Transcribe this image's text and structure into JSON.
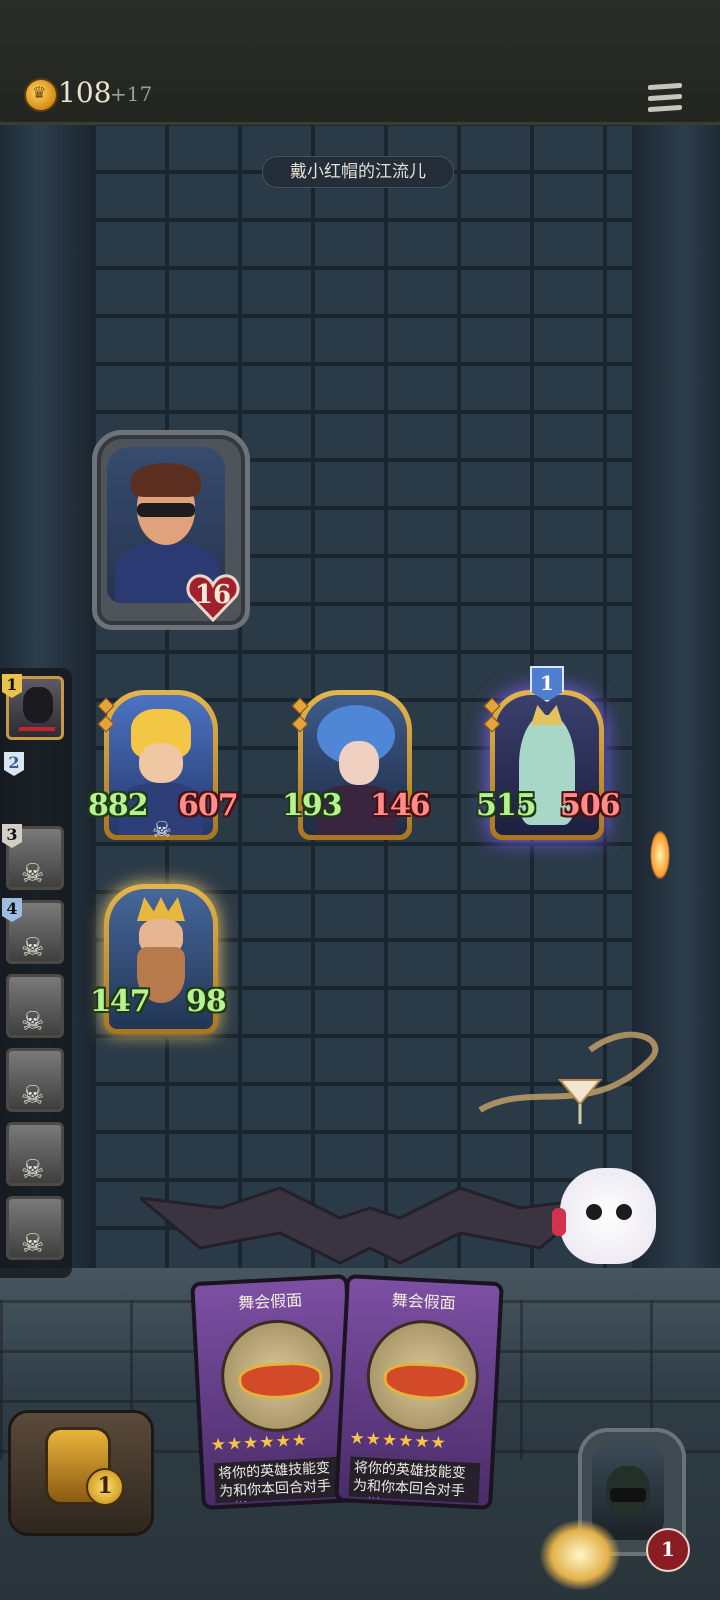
{
  "header": {
    "coins": "108",
    "income": "+17",
    "menu_icon": "hamburger-menu-icon"
  },
  "opponent": {
    "name": "戴小红帽的江流儿",
    "health": "16"
  },
  "board": {
    "minions": [
      {
        "attack": "882",
        "health": "607",
        "tier": null,
        "golden": true
      },
      {
        "attack": "193",
        "health": "146",
        "tier": null,
        "golden": true
      },
      {
        "attack": "515",
        "health": "506",
        "tier": "1",
        "golden": true
      },
      {
        "attack": "147",
        "health": "98",
        "tier": null,
        "golden": true
      }
    ]
  },
  "sidebar": {
    "slots": [
      {
        "rank": "1",
        "state": "active"
      },
      {
        "rank": "2",
        "state": "empty"
      },
      {
        "rank": "3",
        "state": "dead"
      },
      {
        "rank": "4",
        "state": "dead"
      },
      {
        "rank": "",
        "state": "dead"
      },
      {
        "rank": "",
        "state": "dead"
      },
      {
        "rank": "",
        "state": "dead"
      },
      {
        "rank": "",
        "state": "dead"
      }
    ]
  },
  "hand": [
    {
      "name": "舞会假面",
      "stars": "★★★★★★",
      "desc": "将你的英雄技能变为和你本回合对手一样"
    },
    {
      "name": "舞会假面",
      "stars": "★★★★★★",
      "desc": "将你的英雄技能变为和你本回合对手一样"
    }
  ],
  "player": {
    "token_count": "1",
    "health": "1"
  },
  "colors": {
    "gold": "#e3b64d",
    "attack": "#b6f28f",
    "health": "#ff8b8b",
    "card": "#7c4fa3"
  }
}
